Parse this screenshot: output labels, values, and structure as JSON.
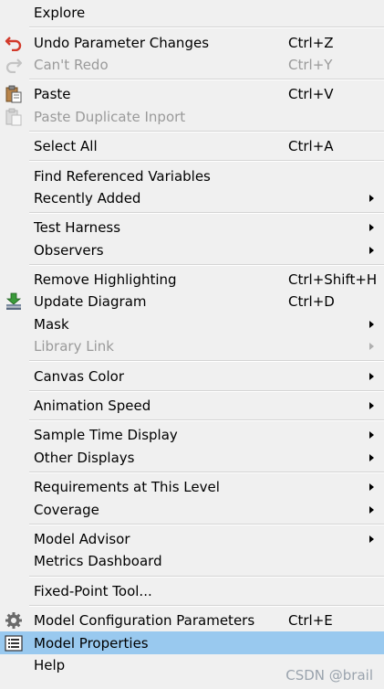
{
  "menu": {
    "explore": "Explore",
    "undo": {
      "label": "Undo Parameter Changes",
      "shortcut": "Ctrl+Z",
      "icon": "undo-icon"
    },
    "redo": {
      "label": "Can't Redo",
      "shortcut": "Ctrl+Y",
      "icon": "redo-icon"
    },
    "paste": {
      "label": "Paste",
      "shortcut": "Ctrl+V",
      "icon": "paste-icon"
    },
    "paste_dup": {
      "label": "Paste Duplicate Inport",
      "icon": "paste-duplicate-icon"
    },
    "select_all": {
      "label": "Select All",
      "shortcut": "Ctrl+A"
    },
    "find_refs": "Find Referenced Variables",
    "recently_added": "Recently Added",
    "test_harness": "Test Harness",
    "observers": "Observers",
    "remove_highlight": {
      "label": "Remove Highlighting",
      "shortcut": "Ctrl+Shift+H"
    },
    "update_diagram": {
      "label": "Update Diagram",
      "shortcut": "Ctrl+D",
      "icon": "update-diagram-icon"
    },
    "mask": "Mask",
    "library_link": "Library Link",
    "canvas_color": "Canvas Color",
    "animation_speed": "Animation Speed",
    "sample_time": "Sample Time Display",
    "other_displays": "Other Displays",
    "requirements": "Requirements at This Level",
    "coverage": "Coverage",
    "model_advisor": "Model Advisor",
    "metrics_dashboard": "Metrics Dashboard",
    "fixed_point": "Fixed-Point Tool...",
    "model_config": {
      "label": "Model Configuration Parameters",
      "shortcut": "Ctrl+E",
      "icon": "gear-icon"
    },
    "model_props": {
      "label": "Model Properties",
      "icon": "properties-list-icon"
    },
    "help": "Help"
  },
  "colors": {
    "highlight": "#99c9ef",
    "disabled": "#9a9a9a"
  },
  "watermark": "CSDN @brail"
}
